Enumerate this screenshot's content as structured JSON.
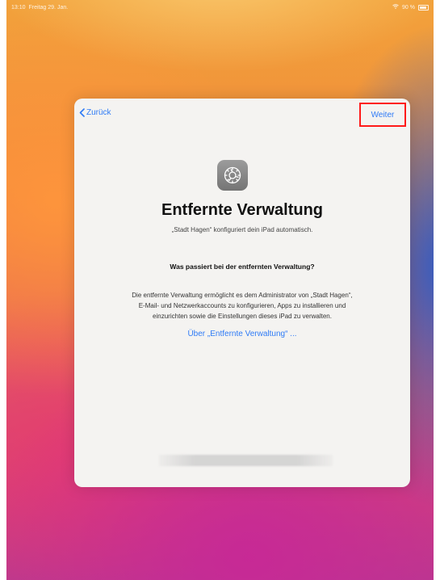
{
  "status_bar": {
    "time": "13:10",
    "date": "Freitag 29. Jan.",
    "battery": "90 %"
  },
  "nav": {
    "back_label": "Zurück",
    "next_label": "Weiter"
  },
  "content": {
    "icon": "settings-gear-icon",
    "title": "Entfernte Verwaltung",
    "subtitle": "„Stadt Hagen“ konfiguriert dein iPad automatisch.",
    "question": "Was passiert bei der entfernten Verwaltung?",
    "body_lines": [
      "Die entfernte Verwaltung ermöglicht es dem Administrator von „Stadt Hagen“,",
      "E-Mail- und Netzwerkaccounts zu konfigurieren, Apps zu installieren und",
      "einzurichten sowie die Einstellungen dieses iPad zu verwalten."
    ],
    "learn_more_link": "Über „Entfernte Verwaltung“ ..."
  },
  "colors": {
    "accent": "#2f7bf6",
    "highlight_border": "#ff1a1a",
    "sheet_background": "#f4f3f1"
  }
}
